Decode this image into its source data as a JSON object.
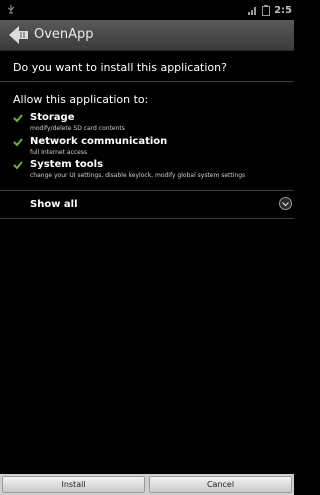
{
  "status_bar": {
    "time": "2:5",
    "icons": [
      "usb-debug-icon",
      "signal-icon",
      "battery-icon"
    ]
  },
  "title_bar": {
    "title": "OvenApp",
    "icon": "back-arrow-icon"
  },
  "content": {
    "question": "Do you want to install this application?",
    "allow_label": "Allow this application to:",
    "permissions": [
      {
        "title": "Storage",
        "detail": "modify/delete SD card contents"
      },
      {
        "title": "Network communication",
        "detail": "full Internet access"
      },
      {
        "title": "System tools",
        "detail": "change your UI settings, disable keylock, modify global system settings"
      }
    ],
    "show_all_label": "Show all"
  },
  "buttons": {
    "install_label": "Install",
    "cancel_label": "Cancel"
  },
  "colors": {
    "check": "#6fb03a",
    "title_bar": "#4a4a4a",
    "background": "#000000"
  }
}
